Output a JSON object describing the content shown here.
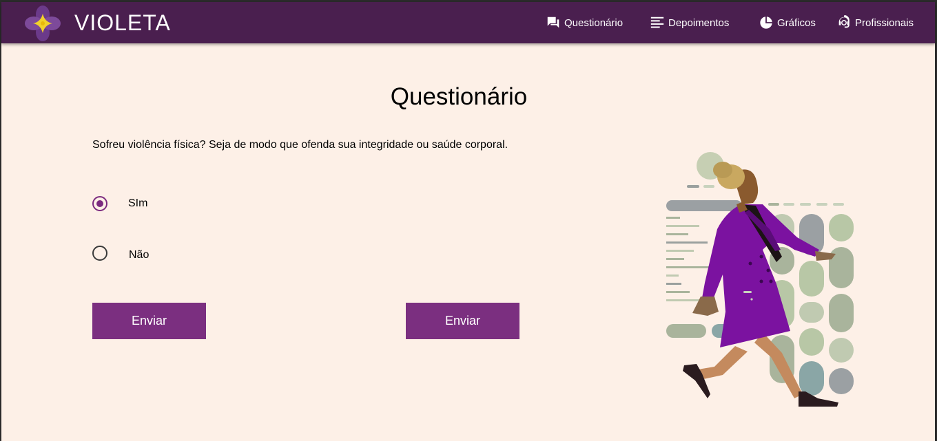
{
  "app": {
    "name": "VIOLETA"
  },
  "nav": {
    "items": [
      {
        "label": "Questionário",
        "icon": "forum-icon"
      },
      {
        "label": "Depoimentos",
        "icon": "text-lines-icon"
      },
      {
        "label": "Gráficos",
        "icon": "pie-chart-icon"
      },
      {
        "label": "Profissionais",
        "icon": "support-agent-icon"
      }
    ]
  },
  "page": {
    "title": "Questionário",
    "question": "Sofreu violência física? Seja de modo que ofenda sua integridade ou saúde corporal.",
    "options": [
      {
        "label": "SIm",
        "selected": true
      },
      {
        "label": "Não",
        "selected": false
      }
    ],
    "buttons": {
      "submit_1": "Enviar",
      "submit_2": "Enviar"
    }
  },
  "colors": {
    "header": "#4a1f4f",
    "background": "#fdf0e7",
    "button": "#7b2f80",
    "accent": "#7b2a7f"
  }
}
